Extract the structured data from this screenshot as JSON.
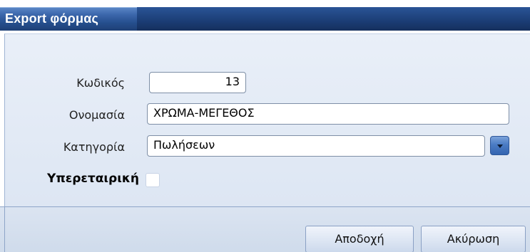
{
  "window": {
    "title": "Export φόρμας"
  },
  "form": {
    "code_label": "Κωδικός",
    "code_value": "13",
    "name_label": "Ονομασία",
    "name_value": "ΧΡΩΜΑ-ΜΕΓΕΘΟΣ",
    "category_label": "Κατηγορία",
    "category_value": "Πωλήσεων",
    "service_label": "Υπερεταιρική",
    "service_checked": false
  },
  "buttons": {
    "accept_label": "Αποδοχή",
    "cancel_label": "Ακύρωση"
  },
  "colors": {
    "titlebar": "#26508f",
    "form_background": "#e3eaf5",
    "footer_background": "#d5dfee"
  },
  "icons": {
    "dropdown": "chevron-down-icon"
  }
}
